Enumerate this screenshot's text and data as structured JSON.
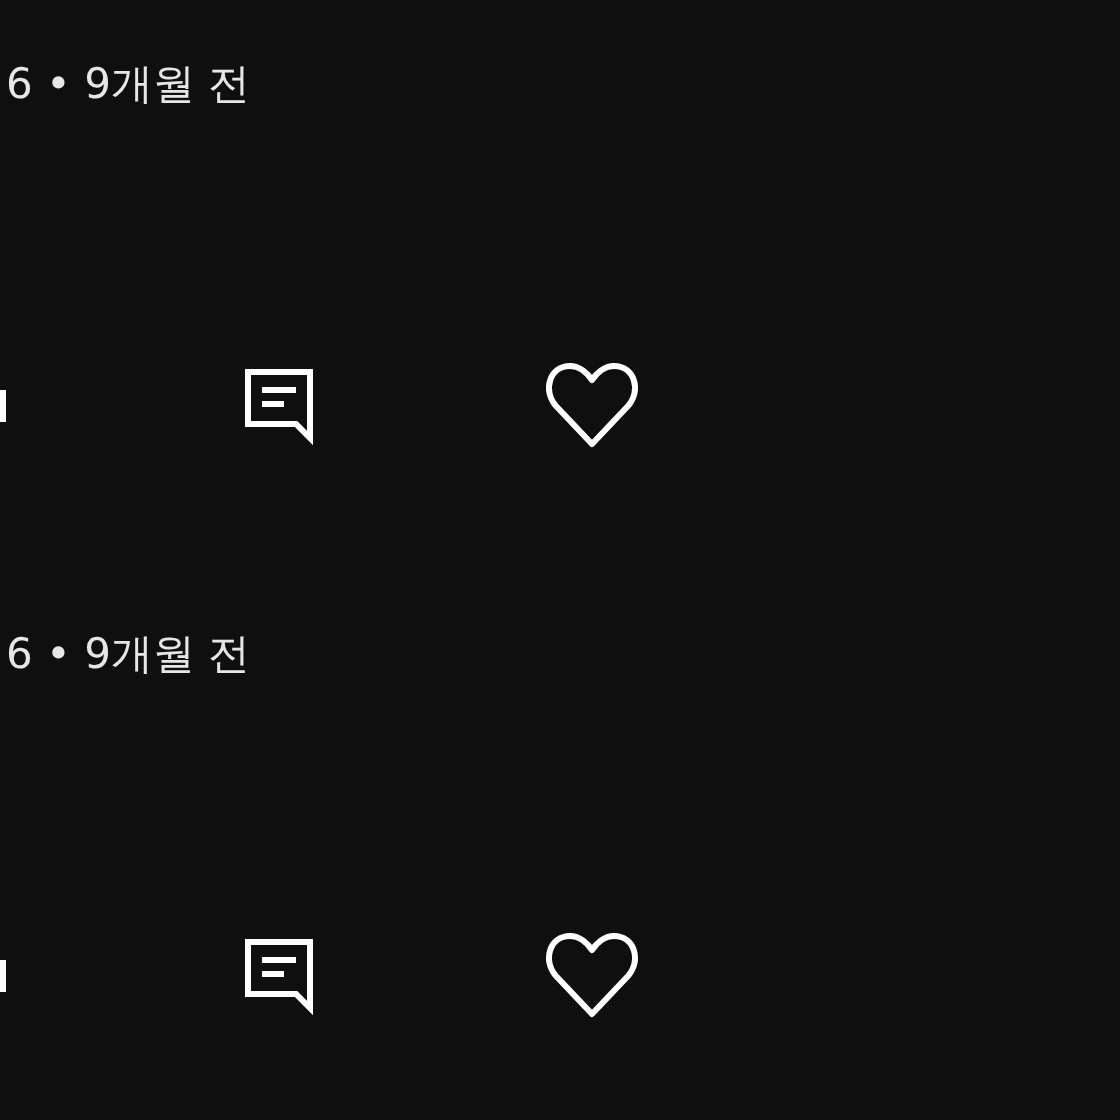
{
  "posts": [
    {
      "meta": "6 • 9개월 전",
      "liked": false
    },
    {
      "meta": "6 • 9개월 전",
      "liked": false
    }
  ]
}
